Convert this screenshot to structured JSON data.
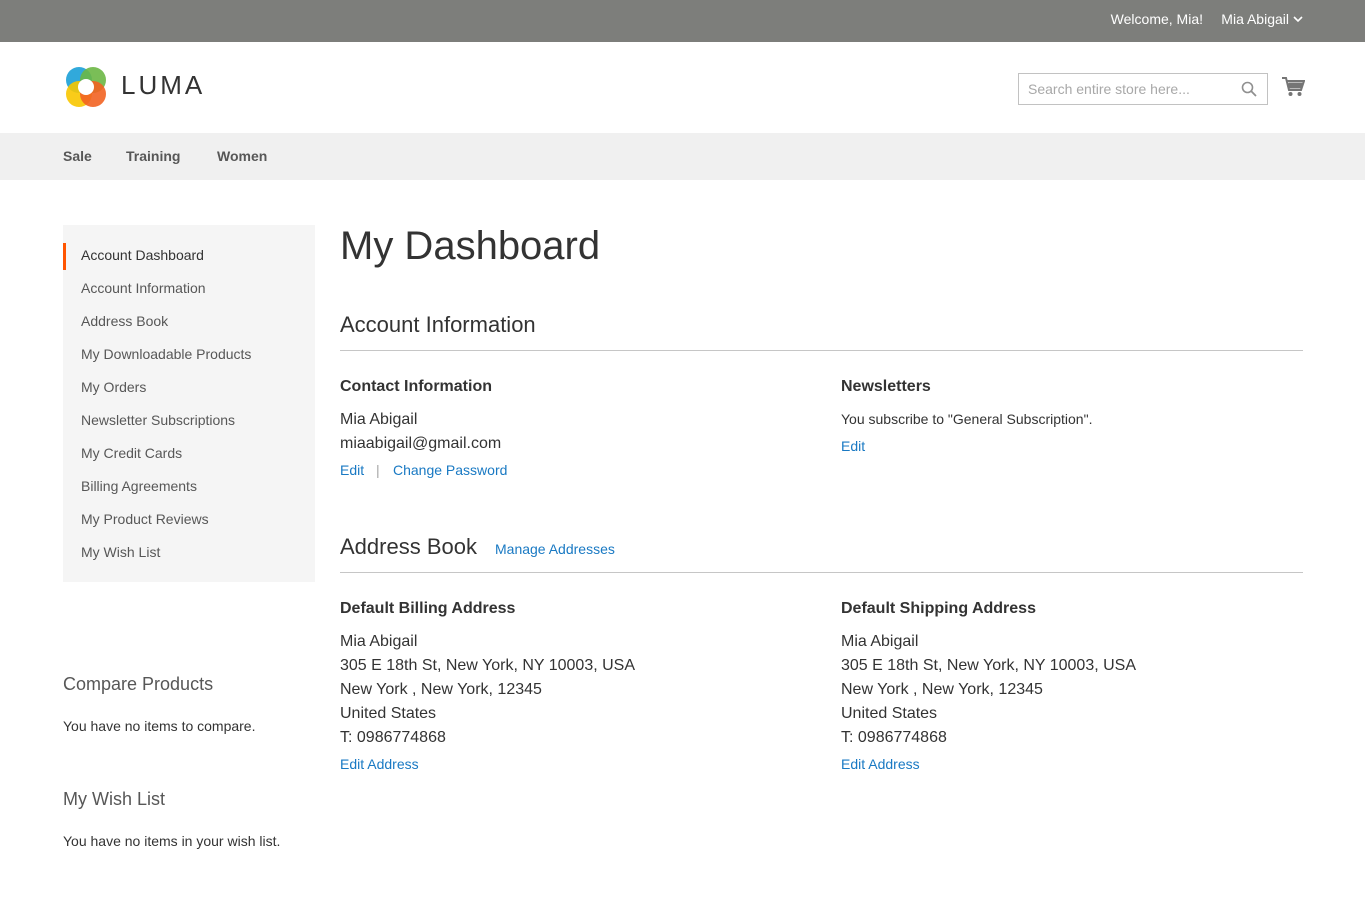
{
  "topbar": {
    "welcome": "Welcome, Mia!",
    "user_name": "Mia Abigail"
  },
  "header": {
    "logo_text": "LUMA",
    "search_placeholder": "Search entire store here..."
  },
  "nav": {
    "items": [
      "Sale",
      "Training",
      "Women"
    ]
  },
  "sidebar": {
    "items": [
      {
        "label": "Account Dashboard",
        "active": true
      },
      {
        "label": "Account Information"
      },
      {
        "label": "Address Book"
      },
      {
        "label": "My Downloadable Products"
      },
      {
        "label": "My Orders"
      },
      {
        "label": "Newsletter Subscriptions"
      },
      {
        "label": "My Credit Cards"
      },
      {
        "label": "Billing Agreements"
      },
      {
        "label": "My Product Reviews"
      },
      {
        "label": "My Wish List"
      }
    ],
    "compare": {
      "title": "Compare Products",
      "text": "You have no items to compare."
    },
    "wishlist": {
      "title": "My Wish List",
      "text": "You have no items in your wish list."
    }
  },
  "main": {
    "page_title": "My Dashboard",
    "account_info": {
      "title": "Account Information",
      "contact": {
        "title": "Contact Information",
        "name": "Mia Abigail",
        "email": "miaabigail@gmail.com",
        "edit": "Edit",
        "separator": "|",
        "change_password": "Change Password"
      },
      "newsletters": {
        "title": "Newsletters",
        "text": "You subscribe to \"General Subscription\".",
        "edit": "Edit"
      }
    },
    "address_book": {
      "title": "Address Book",
      "manage": "Manage Addresses",
      "billing": {
        "title": "Default Billing Address",
        "name": "Mia Abigail",
        "street": "305 E 18th St, New York, NY 10003, USA",
        "city": "New York , New York, 12345",
        "country": "United States",
        "phone": "T: 0986774868",
        "edit": "Edit Address"
      },
      "shipping": {
        "title": "Default Shipping Address",
        "name": "Mia Abigail",
        "street": "305 E 18th St, New York, NY 10003, USA",
        "city": "New York , New York, 12345",
        "country": "United States",
        "phone": "T: 0986774868",
        "edit": "Edit Address"
      }
    }
  },
  "colors": {
    "topbar_bg": "#7d7e7b",
    "link": "#1979c3",
    "active_marker": "#ff5501",
    "nav_bg": "#f0f0f0",
    "sidebar_bg": "#f5f5f5"
  }
}
